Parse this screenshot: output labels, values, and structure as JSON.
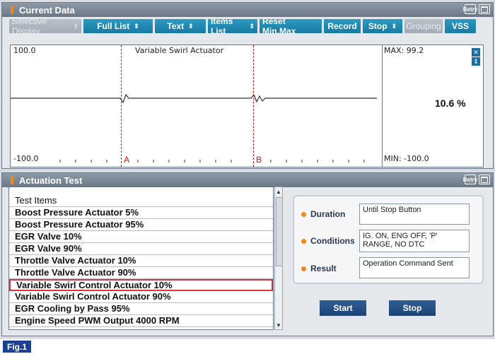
{
  "current_data": {
    "title": "Current Data",
    "refresh_icon_text": "Retry",
    "toolbar": [
      {
        "label": "Selective Display",
        "arrows": "⇕",
        "disabled": true
      },
      {
        "label": "Full List",
        "arrows": "⇕",
        "disabled": false
      },
      {
        "label": "Text",
        "arrows": "⇕",
        "disabled": false
      },
      {
        "label": "Items List",
        "arrows": "⇕",
        "disabled": false
      },
      {
        "label": "Reset Min.Max",
        "arrows": "",
        "disabled": false
      },
      {
        "label": "Record",
        "arrows": "",
        "disabled": false
      },
      {
        "label": "Stop",
        "arrows": "⇕",
        "disabled": false
      },
      {
        "label": "Grouping",
        "arrows": "",
        "disabled": true
      },
      {
        "label": "VSS",
        "arrows": "",
        "disabled": false
      }
    ],
    "graph": {
      "y_max_label": "100.0",
      "y_min_label": "-100.0",
      "signal_name": "Variable Swirl Actuator",
      "max_label": "MAX: 99.2",
      "min_label": "MIN: -100.0",
      "current_value": "10.6 %",
      "cursor_a": "A",
      "cursor_b": "B"
    }
  },
  "actuation_test": {
    "title": "Actuation Test",
    "refresh_icon_text": "Retry",
    "list_header": "Test Items",
    "items": [
      "Boost Pressure Actuator 5%",
      "Boost Pressure Actuator 95%",
      "EGR Valve 10%",
      "EGR Valve 90%",
      "Throttle Valve Actuator 10%",
      "Throttle Valve Actuator 90%",
      "Variable Swirl Control Actuator 10%",
      "Variable Swirl Control Actuator 90%",
      "EGR Cooling by Pass 95%",
      "Engine Speed PWM Output 4000 RPM"
    ],
    "selected_index": 6,
    "info": {
      "duration_label": "Duration",
      "duration_value": "Until Stop Button",
      "conditions_label": "Conditions",
      "conditions_value": "IG. ON, ENG OFF, 'P' RANGE, NO DTC",
      "result_label": "Result",
      "result_value": "Operation Command Sent"
    },
    "start_label": "Start",
    "stop_label": "Stop"
  },
  "figure_label": "Fig.1",
  "colors": {
    "title_bar": "#6a7886",
    "toolbar_button": "#1a7aa3",
    "accent_orange": "#f08a1c",
    "cursor_red": "#e01010",
    "selection_red": "#d9363e",
    "action_button": "#1d4477",
    "figure_badge": "#1b3f93"
  }
}
